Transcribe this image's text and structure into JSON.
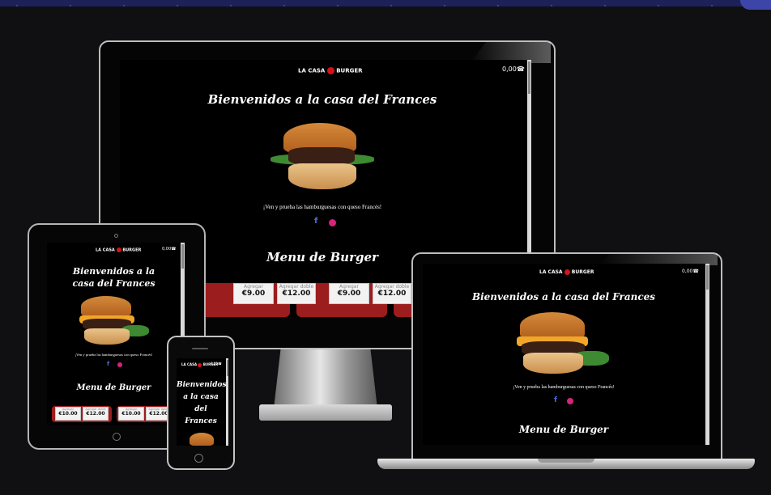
{
  "site": {
    "logo": "LA CASA BURGER",
    "logo_left": "LA CASA",
    "logo_right": "BURGER",
    "cart_total": "0,00",
    "hero_title": "Bienvenidos a la casa del Frances",
    "tagline": "¡Ven y prueba las hamburguesas con queso Francés!",
    "facebook_glyph": "f",
    "menu_title": "Menu de Burger"
  },
  "menu_cards": [
    {
      "label": "Agregar",
      "price": "€9.00"
    },
    {
      "label": "Agregar doble",
      "price": "€12.00"
    },
    {
      "label": "Agregar",
      "price": "€9.00"
    },
    {
      "label": "Agregar doble",
      "price": "€12.00"
    }
  ],
  "tablet_cards": [
    {
      "label": "Agregar",
      "price": "€10.00"
    },
    {
      "label": "Agregar doble",
      "price": "€12.00"
    },
    {
      "label": "Agregar",
      "price": "€10.00"
    },
    {
      "label": "Agregar doble",
      "price": "€12.00"
    }
  ],
  "phone": {
    "hero_lines": [
      "Bienvenidos",
      "a la casa",
      "del",
      "Frances"
    ]
  },
  "colors": {
    "background": "#101012",
    "brand_red": "#d4141b",
    "facebook": "#4a6fd8",
    "instagram": "#d6247a"
  }
}
